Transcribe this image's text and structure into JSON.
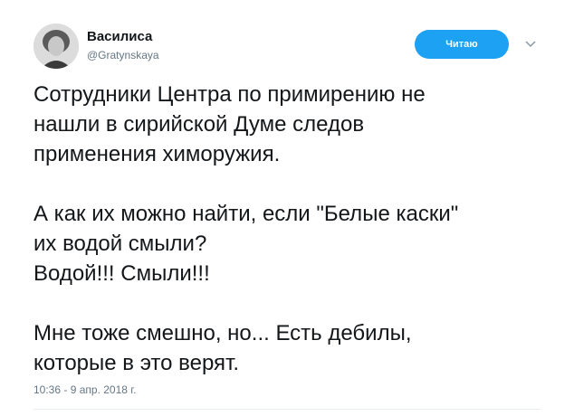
{
  "tweet": {
    "author": {
      "display_name": "Василиса",
      "username": "@Gratynskaya"
    },
    "follow_button_label": "Читаю",
    "text": "Сотрудники Центра по примирению не\nнашли в сирийской Думе следов\nприменения химоружия.\n\nА как их можно найти, если \"Белые каски\"\nих водой смыли?\nВодой!!! Смыли!!!\n\nМне тоже смешно, но... Есть дебилы,\nкоторые в это верят.",
    "timestamp": "10:36 - 9 апр. 2018 г."
  },
  "icons": {
    "menu": "chevron-down-icon"
  },
  "colors": {
    "accent": "#1da1f2",
    "text": "#14171a",
    "secondary_text": "#657786",
    "divider": "#e6ecf0"
  }
}
